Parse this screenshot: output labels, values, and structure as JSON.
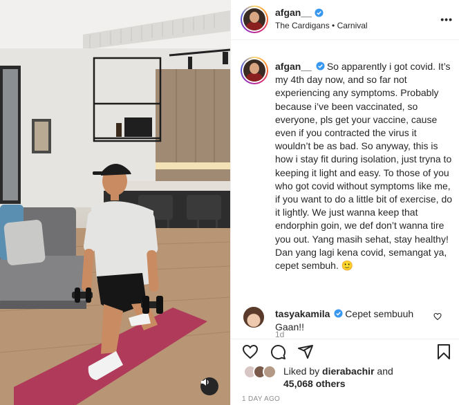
{
  "header": {
    "username": "afgan__",
    "audio": "The Cardigans • Carnival",
    "more_label": "•••"
  },
  "caption": {
    "username": "afgan__",
    "text": "So apparently i got covid. It’s my 4th day now, and so far not experiencing any symptoms. Probably because i’ve been vaccinated, so everyone, pls get your vaccine, cause even if you contracted the virus it wouldn’t be as bad. So anyway, this is how i stay fit during isolation, just tryna to keeping it light and easy. To those of you who got covid without symptoms like me, if you want to do a little bit of exercise, do it lightly. We just wanna keep that endorphin goin, we def don’t wanna tire you out. Yang masih sehat, stay healthy! Dan yang lagi kena covid, semangat ya, cepet sembuh. ",
    "emoji": "🙂",
    "time": "1d"
  },
  "comment": {
    "username": "tasyakamila",
    "text": "Cepet sembuuh Gaan!!"
  },
  "likes": {
    "prefix": "Liked by ",
    "user": "dierabachir",
    "middle": " and",
    "count": "45,068 others"
  },
  "posted_ago": "1 DAY AGO",
  "icons": {
    "header_verified": "verified-badge-icon",
    "like": "heart-icon",
    "comment": "comment-icon",
    "share": "share-icon",
    "save": "bookmark-icon",
    "mute": "speaker-icon"
  },
  "colors": {
    "verified": "#3897f0",
    "text": "#262626",
    "muted": "#8e8e8e",
    "border": "#efefef"
  }
}
